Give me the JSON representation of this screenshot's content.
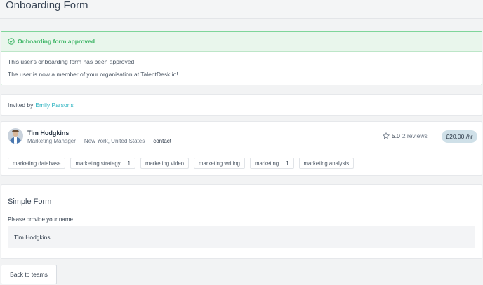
{
  "page": {
    "title": "Onboarding Form"
  },
  "alert": {
    "title": "Onboarding form approved",
    "lines": [
      "This user's onboarding form has been approved.",
      "The user is now a member of your organisation at TalentDesk.io!"
    ]
  },
  "invited": {
    "prefix": "Invited by",
    "name": "Emily Parsons"
  },
  "profile": {
    "name": "Tim Hodgkins",
    "role": "Marketing Manager",
    "location": "New York, United States",
    "contact": "contact",
    "rating": "5.0",
    "reviews": "2 reviews",
    "rate": "£20.00 /hr",
    "skills": [
      {
        "label": "marketing database",
        "count": ""
      },
      {
        "label": "marketing strategy",
        "count": "1"
      },
      {
        "label": "marketing video",
        "count": ""
      },
      {
        "label": "marketing writing",
        "count": ""
      },
      {
        "label": "marketing",
        "count": "1"
      },
      {
        "label": "marketing analysis",
        "count": ""
      }
    ],
    "more": "..."
  },
  "form": {
    "title": "Simple Form",
    "question": "Please provide your name",
    "answer": "Tim Hodgkins"
  },
  "actions": {
    "back_label": "Back to teams"
  },
  "colors": {
    "success": "#3bb464",
    "link": "#2bb3c0",
    "rate_badge": "#cfe0e8"
  }
}
